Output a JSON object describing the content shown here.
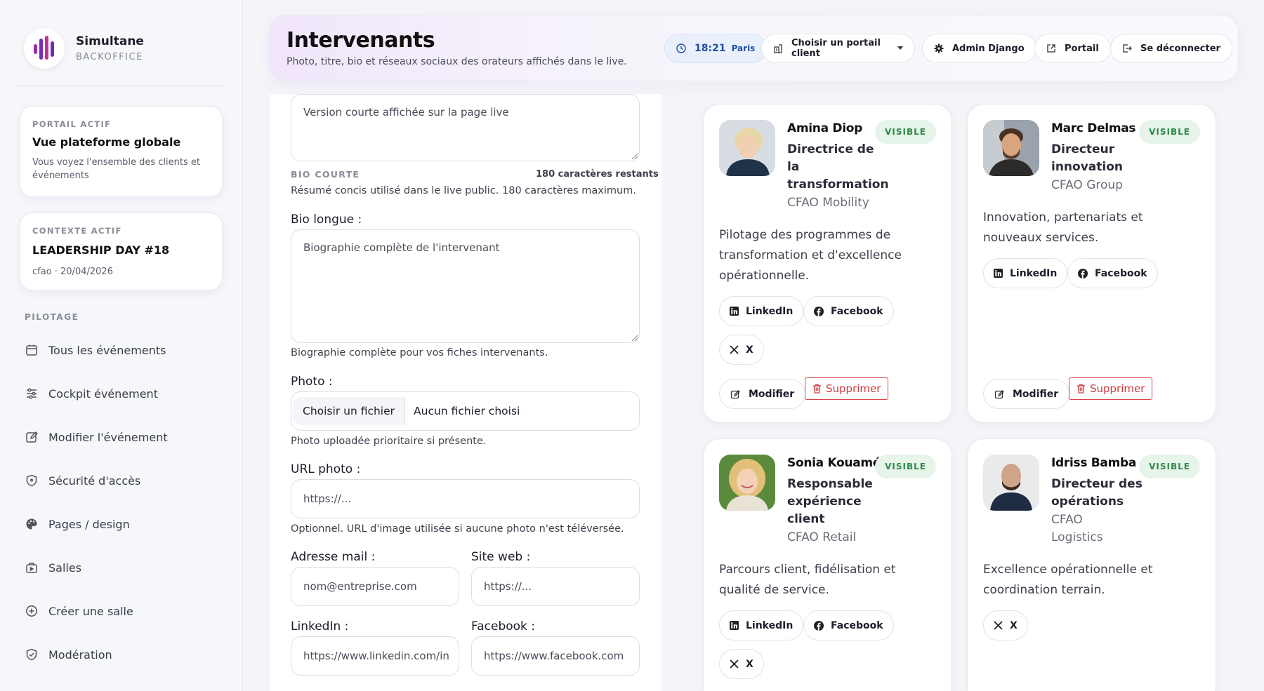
{
  "brand": {
    "name": "Simultane",
    "sub": "BACKOFFICE"
  },
  "portal_card": {
    "label": "PORTAIL ACTIF",
    "title": "Vue plateforme globale",
    "desc": "Vous voyez l'ensemble des clients et événements"
  },
  "context_card": {
    "label": "CONTEXTE ACTIF",
    "title": "LEADERSHIP DAY #18",
    "desc": "cfao · 20/04/2026"
  },
  "nav": {
    "section": "PILOTAGE",
    "items": [
      {
        "label": "Tous les événements",
        "icon": "calendar-icon"
      },
      {
        "label": "Cockpit événement",
        "icon": "sliders-icon"
      },
      {
        "label": "Modifier l'événement",
        "icon": "edit-icon"
      },
      {
        "label": "Sécurité d'accès",
        "icon": "shield-icon"
      },
      {
        "label": "Pages / design",
        "icon": "palette-icon"
      },
      {
        "label": "Salles",
        "icon": "room-icon"
      },
      {
        "label": "Créer une salle",
        "icon": "plus-circle-icon"
      },
      {
        "label": "Modération",
        "icon": "shield-check-icon"
      }
    ]
  },
  "header": {
    "title": "Intervenants",
    "subtitle": "Photo, titre, bio et réseaux sociaux des orateurs affichés dans le live.",
    "time": "18:21",
    "city": "Paris",
    "portal_select": "Choisir un portail client",
    "admin": "Admin Django",
    "portal": "Portail",
    "logout": "Se déconnecter"
  },
  "form": {
    "bio_short_placeholder": "Version courte affichée sur la page live",
    "bio_short_label": "BIO COURTE",
    "bio_short_count": "180 caractères restants",
    "bio_short_help": "Résumé concis utilisé dans le live public. 180 caractères maximum.",
    "bio_long_label": "Bio longue :",
    "bio_long_placeholder": "Biographie complète de l'intervenant",
    "bio_long_help": "Biographie complète pour vos fiches intervenants.",
    "photo_label": "Photo :",
    "photo_button": "Choisir un fichier",
    "photo_status": "Aucun fichier choisi",
    "photo_help": "Photo uploadée prioritaire si présente.",
    "url_label": "URL photo :",
    "url_placeholder": "https://...",
    "url_help": "Optionnel. URL d'image utilisée si aucune photo n'est téléversée.",
    "email_label": "Adresse mail :",
    "email_placeholder": "nom@entreprise.com",
    "site_label": "Site web :",
    "site_placeholder": "https://...",
    "linkedin_label": "LinkedIn :",
    "linkedin_placeholder": "https://www.linkedin.com/in",
    "facebook_label": "Facebook :",
    "facebook_placeholder": "https://www.facebook.com"
  },
  "speakers": [
    {
      "name": "Amina Diop",
      "role": "Directrice de la transformation",
      "company": "CFAO Mobility",
      "badge": "VISIBLE",
      "desc": "Pilotage des programmes de transformation et d'excellence opérationnelle.",
      "linkedin": "LinkedIn",
      "facebook": "Facebook",
      "x": "X",
      "edit": "Modifier",
      "delete": "Supprimer"
    },
    {
      "name": "Marc Delmas",
      "role": "Directeur innovation",
      "company": "CFAO Group",
      "badge": "VISIBLE",
      "desc": "Innovation, partenariats et nouveaux services.",
      "linkedin": "LinkedIn",
      "facebook": "Facebook",
      "edit": "Modifier",
      "delete": "Supprimer"
    },
    {
      "name": "Sonia Kouamé",
      "role": "Responsable expérience client",
      "company": "CFAO Retail",
      "badge": "VISIBLE",
      "desc": "Parcours client, fidélisation et qualité de service.",
      "linkedin": "LinkedIn",
      "facebook": "Facebook",
      "x": "X"
    },
    {
      "name": "Idriss Bamba",
      "role": "Directeur des opérations",
      "company": "CFAO Logistics",
      "badge": "VISIBLE",
      "desc": "Excellence opérationnelle et coordination terrain.",
      "x": "X"
    }
  ]
}
